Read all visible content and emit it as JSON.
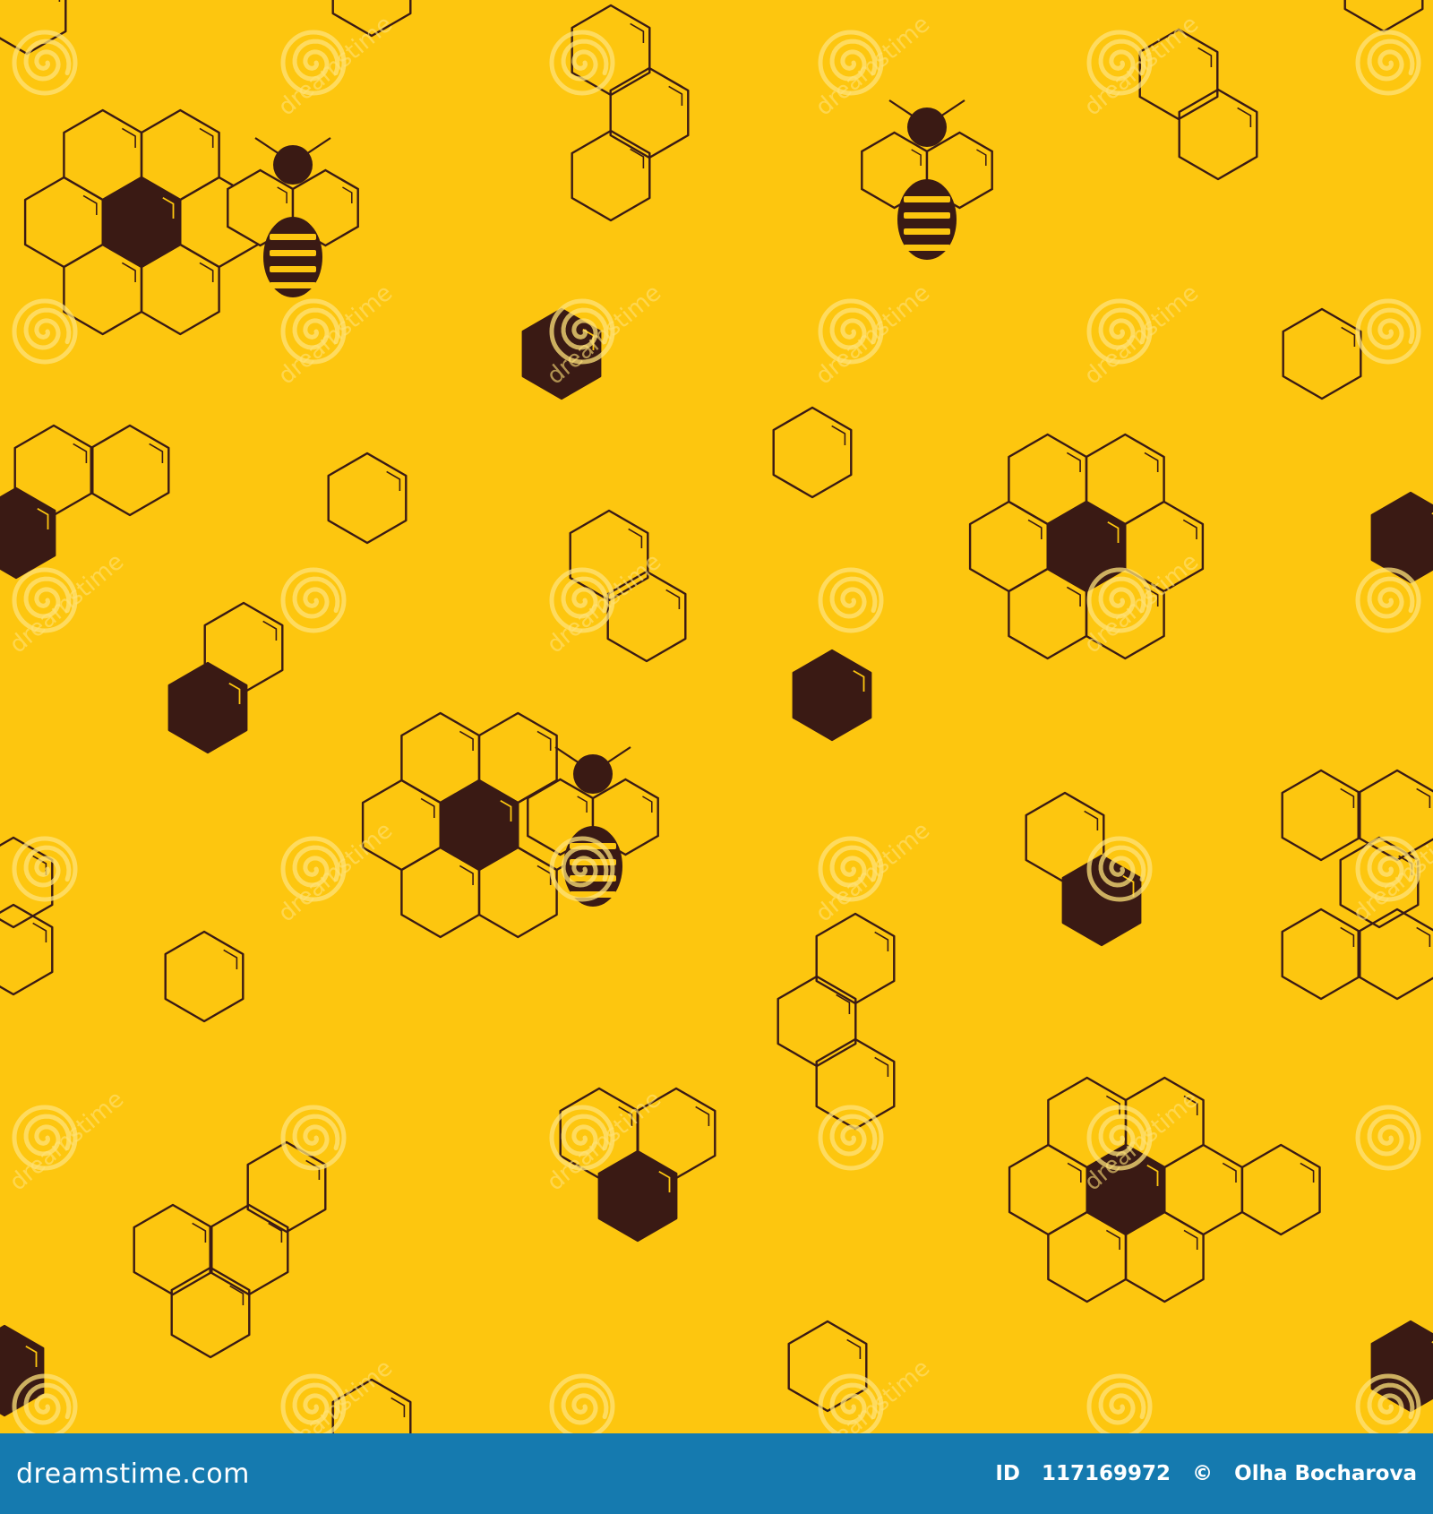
{
  "colors": {
    "background": "#FDC60F",
    "ink": "#3A1A14",
    "watermark": "#FFE27A",
    "footer": "#157AAF",
    "footer_text": "#FFFFFF"
  },
  "pattern": {
    "motifs": [
      "honeycomb-cluster-icon",
      "bee-icon",
      "hexagon-outline-icon",
      "hexagon-filled-icon"
    ],
    "watermark_text": "dreamstime",
    "watermark_icon": "spiral-icon"
  },
  "footer": {
    "brand": "dreamstime.com",
    "image_id_label": "ID",
    "image_id": "117169972",
    "copyright_symbol": "©",
    "author": "Olha Bocharova"
  }
}
